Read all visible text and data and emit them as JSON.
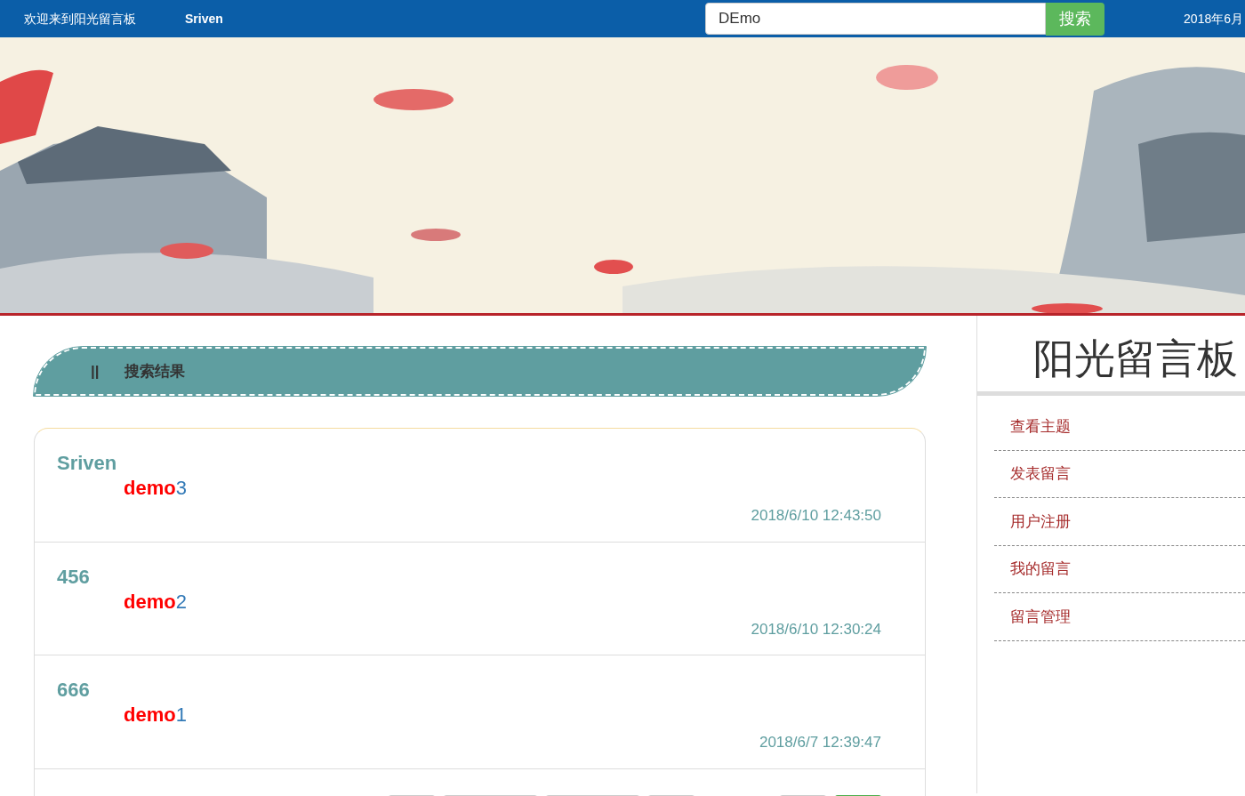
{
  "topbar": {
    "welcome": "欢迎来到阳光留言板",
    "user": "Sriven",
    "search": {
      "value": "DEmo",
      "button": "搜索"
    },
    "date": "2018年6月"
  },
  "section_header": {
    "marker": "||",
    "title": "搜索结果"
  },
  "messages": [
    {
      "author": "Sriven",
      "keyword": "demo",
      "rest": "3",
      "time": "2018/6/10 12:43:50"
    },
    {
      "author": "456",
      "keyword": "demo",
      "rest": "2",
      "time": "2018/6/10 12:30:24"
    },
    {
      "author": "666",
      "keyword": "demo",
      "rest": "1",
      "time": "2018/6/7 12:39:47"
    }
  ],
  "pager": [
    {
      "selected": false
    },
    {
      "selected": false
    },
    {
      "selected": false
    },
    {
      "selected": false
    },
    {
      "selected": false
    },
    {
      "selected": true
    }
  ],
  "sidebar": {
    "title": "阳光留言板",
    "items": [
      "查看主题",
      "发表留言",
      "用户注册",
      "我的留言",
      "留言管理"
    ]
  }
}
